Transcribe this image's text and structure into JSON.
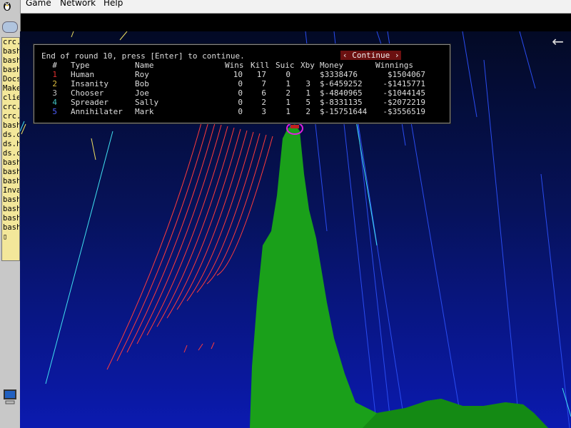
{
  "menu": {
    "game": "Game",
    "network": "Network",
    "help": "Help"
  },
  "tasks": [
    "crc.",
    "bash",
    "bash",
    "bash",
    "Docs",
    "Make",
    "clie",
    "crc.",
    "crc.",
    "bash",
    "ds.c",
    "ds.h",
    "ds.c",
    "bash",
    "bash",
    "bash",
    "Inva",
    "bash",
    "bash",
    "bash",
    "bash",
    "▯"
  ],
  "scoreboard": {
    "message": "End of round 10, press [Enter] to continue.",
    "continue_label": "‹ Continue ›",
    "headers": {
      "num": "#",
      "type": "Type",
      "name": "Name",
      "wins": "Wins",
      "kill": "Kill",
      "suic": "Suic",
      "xby": "Xby",
      "money": "Money",
      "winnings": "Winnings"
    },
    "rows": [
      {
        "num": "1",
        "type": "Human",
        "name": "Roy",
        "wins": "10",
        "kill": "17",
        "suic": "0",
        "xby": "",
        "money": "$3338476",
        "winnings": "$1504067",
        "color": "#e03030"
      },
      {
        "num": "2",
        "type": "Insanity",
        "name": "Bob",
        "wins": "0",
        "kill": "7",
        "suic": "1",
        "xby": "3",
        "money": "$-6459252",
        "winnings": "-$1415771",
        "color": "#e0c040"
      },
      {
        "num": "3",
        "type": "Chooser",
        "name": "Joe",
        "wins": "0",
        "kill": "6",
        "suic": "2",
        "xby": "1",
        "money": "$-4840965",
        "winnings": "-$1044145",
        "color": "#c0c0c0"
      },
      {
        "num": "4",
        "type": "Spreader",
        "name": "Sally",
        "wins": "0",
        "kill": "2",
        "suic": "1",
        "xby": "5",
        "money": "$-8331135",
        "winnings": "-$2072219",
        "color": "#40c0c0"
      },
      {
        "num": "5",
        "type": "Annihilater",
        "name": "Mark",
        "wins": "0",
        "kill": "3",
        "suic": "1",
        "xby": "2",
        "money": "$-15751644",
        "winnings": "-$3556519",
        "color": "#5060ff"
      }
    ]
  },
  "icons": {
    "back": "left-arrow-icon",
    "logo": "tux-icon",
    "tray": "computer-icon"
  },
  "colors": {
    "terrain": "#1aa01a",
    "tank_marker": "#e020e0",
    "red_trail": "#ff3b3b",
    "cyan_trail": "#40e0f0",
    "blue_trail": "#2a4cf0",
    "yellow_trail": "#f0e060"
  }
}
